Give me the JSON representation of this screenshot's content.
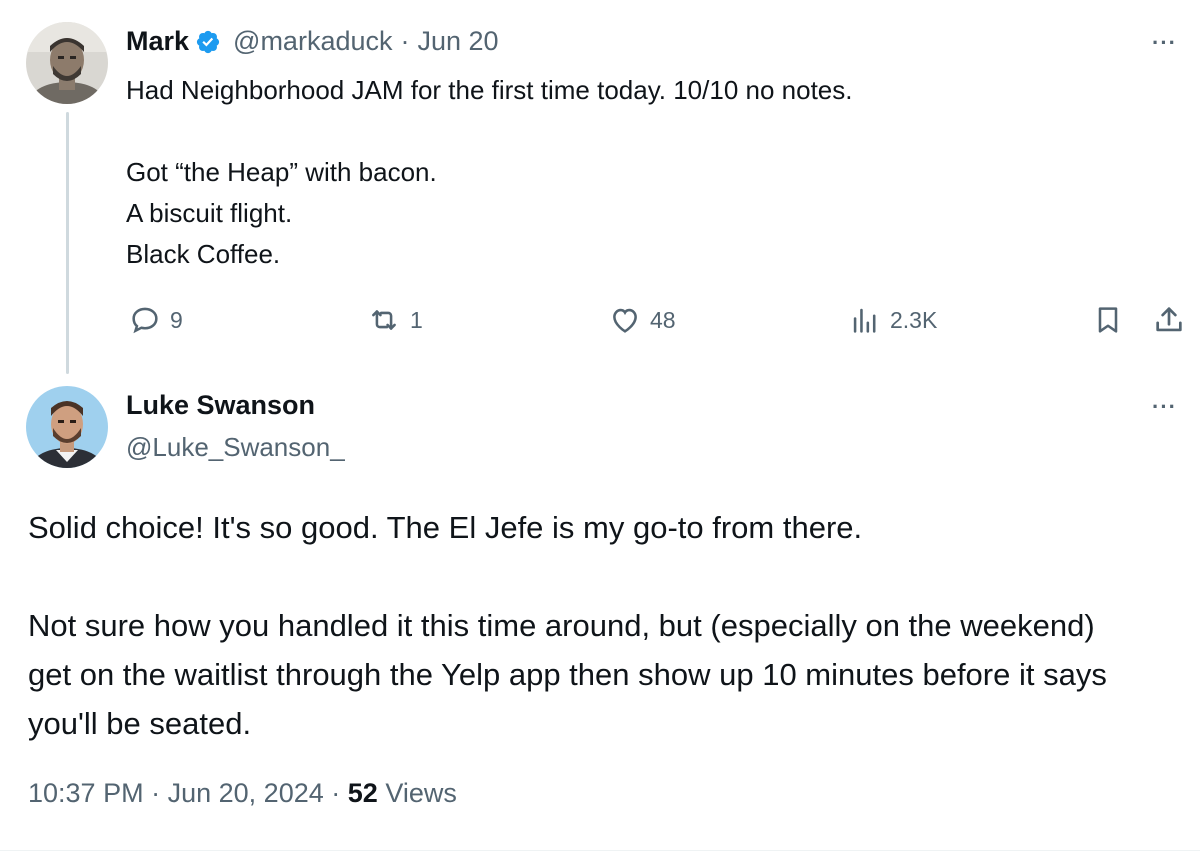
{
  "tweet_parent": {
    "author_name": "Mark",
    "verified": true,
    "handle": "@markaduck",
    "separator": "·",
    "date": "Jun 20",
    "text_lines": [
      "Had Neighborhood JAM for the first time today. 10/10 no notes.",
      "",
      "Got “the Heap” with bacon.",
      "A biscuit flight.",
      "Black Coffee."
    ],
    "actions": {
      "replies": "9",
      "reposts": "1",
      "likes": "48",
      "views": "2.3K"
    },
    "more_label": "···"
  },
  "tweet_main": {
    "author_name": "Luke Swanson",
    "handle": "@Luke_Swanson_",
    "more_label": "···",
    "paragraphs": [
      "Solid choice! It's so good. The El Jefe is my go-to from there.",
      "Not sure how you handled it this time around, but (especially on the weekend) get on the waitlist through the Yelp app then show up 10 minutes before it says you'll be seated."
    ],
    "meta": {
      "time": "10:37 PM",
      "sep1": "·",
      "date": "Jun 20, 2024",
      "sep2": "·",
      "views_count": "52",
      "views_label": "Views"
    }
  },
  "icons": {
    "reply": "speech-bubble-icon",
    "repost": "repost-arrows-icon",
    "like": "heart-icon",
    "views": "bar-chart-icon",
    "bookmark": "bookmark-icon",
    "share": "share-upload-icon",
    "verified": "verified-badge-icon"
  },
  "colors": {
    "text_primary": "#0f1419",
    "text_secondary": "#536471",
    "verified_blue": "#1d9bf0",
    "thread_line": "#cfd9de"
  }
}
